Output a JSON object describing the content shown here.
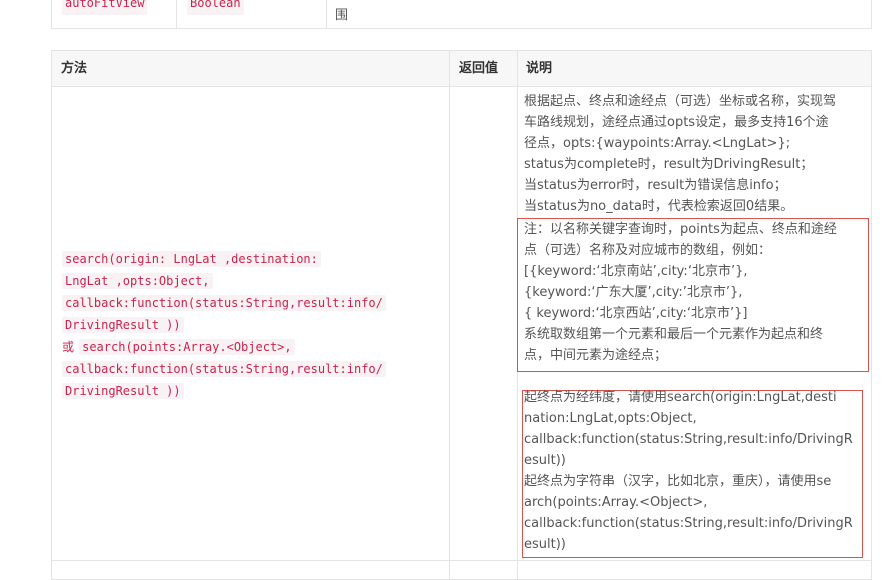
{
  "prev_row": {
    "name": "autoFitView",
    "type": "Boolean",
    "desc_tail": "围"
  },
  "table": {
    "headers": {
      "method": "方法",
      "returns": "返回值",
      "desc": "说明"
    },
    "row": {
      "method_lines": [
        "search(origin: LngLat ,destination:",
        "LngLat ,opts:Object,",
        "callback:function(status:String,result:info/",
        "DrivingResult ))"
      ],
      "or_label": "或",
      "method2_first": "search(points:Array.<Object>,",
      "method2_lines": [
        "callback:function(status:String,result:info/",
        "DrivingResult ))"
      ],
      "returns": "",
      "desc_lines": [
        "根据起点、终点和途经点（可选）坐标或名称，实现驾",
        "车路线规划，途经点通过opts设定，最多支持16个途",
        "径点，opts:{waypoints:Array.<LngLat>};",
        "status为complete时，result为DrivingResult；",
        "当status为error时，result为错误信息info；",
        "当status为no_data时，代表检索返回0结果。"
      ],
      "note_lines": [
        "注：以名称关键字查询时，points为起点、终点和途经",
        "点（可选）名称及对应城市的数组，例如：",
        "[{keyword:‘北京南站’,city:‘北京市’},",
        "{keyword:‘广东大厦’,city:’北京市’},",
        "{ keyword:‘北京西站’,city:‘北京市’}]",
        "系统取数组第一个元素和最后一个元素作为起点和终",
        "点，中间元素为途经点；"
      ],
      "tip_lines": [
        " 起终点为经纬度，请使用search(origin:LngLat,desti",
        "nation:LngLat,opts:Object,",
        "callback:function(status:String,result:info/DrivingR",
        "esult))",
        "起终点为字符串（汉字，比如北京，重庆），请使用se",
        "arch(points:Array.<Object>,",
        "callback:function(status:String,result:info/DrivingR",
        "esult))"
      ]
    }
  }
}
